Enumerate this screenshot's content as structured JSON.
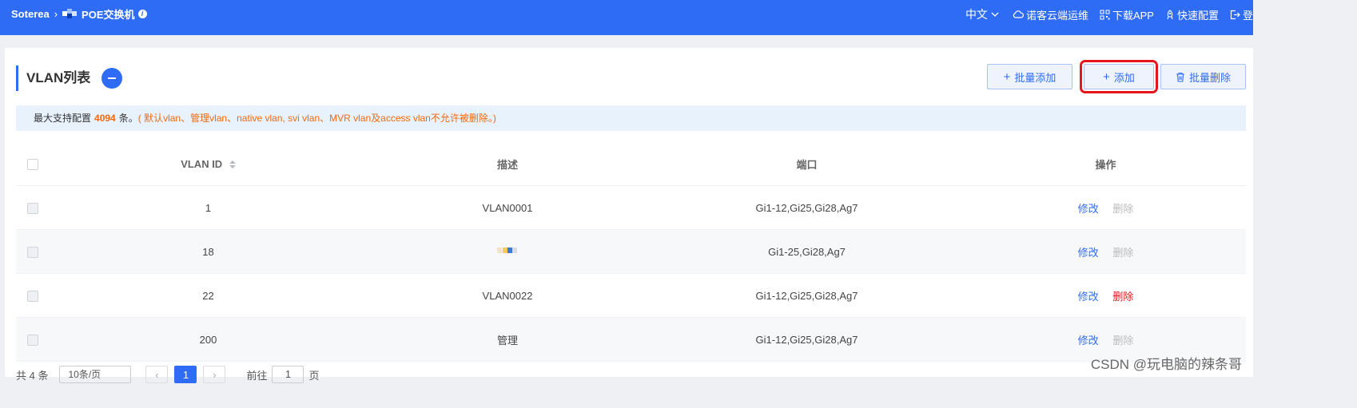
{
  "header": {
    "brand": "Soterea",
    "device": "POE交换机",
    "language": "中文",
    "cloud": "诺客云端运维",
    "download": "下载APP",
    "quick_config": "快速配置",
    "login": "登"
  },
  "card": {
    "title": "VLAN列表",
    "buttons": {
      "batch_add": "批量添加",
      "add": "添加",
      "batch_delete": "批量删除"
    },
    "notice": {
      "prefix": "最大支持配置",
      "max": "4094",
      "suffix": "条。",
      "warning": "( 默认vlan、管理vlan、native vlan, svi vlan、MVR vlan及access vlan不允许被删除。)"
    }
  },
  "table": {
    "columns": [
      "VLAN ID",
      "描述",
      "端口",
      "操作"
    ],
    "rows": [
      {
        "id": "1",
        "desc": "VLAN0001",
        "ports": "Gi1-12,Gi25,Gi28,Ag7",
        "edit": "修改",
        "delete": "删除"
      },
      {
        "id": "18",
        "desc": "",
        "ports": "Gi1-25,Gi28,Ag7",
        "edit": "修改",
        "delete": "删除"
      },
      {
        "id": "22",
        "desc": "VLAN0022",
        "ports": "Gi1-12,Gi25,Gi28,Ag7",
        "edit": "修改",
        "delete": "删除"
      },
      {
        "id": "200",
        "desc": "管理",
        "ports": "Gi1-12,Gi25,Gi28,Ag7",
        "edit": "修改",
        "delete": "删除"
      }
    ]
  },
  "pager": {
    "total": "共 4 条",
    "page_size": "10条/页",
    "current": "1",
    "goto": "前往",
    "goto_value": "1",
    "page_unit": "页"
  },
  "watermark": "CSDN @玩电脑的辣条哥",
  "colors": {
    "accent": "#2f6cf6",
    "warning": "#f06a0f",
    "danger": "#e5161b"
  }
}
